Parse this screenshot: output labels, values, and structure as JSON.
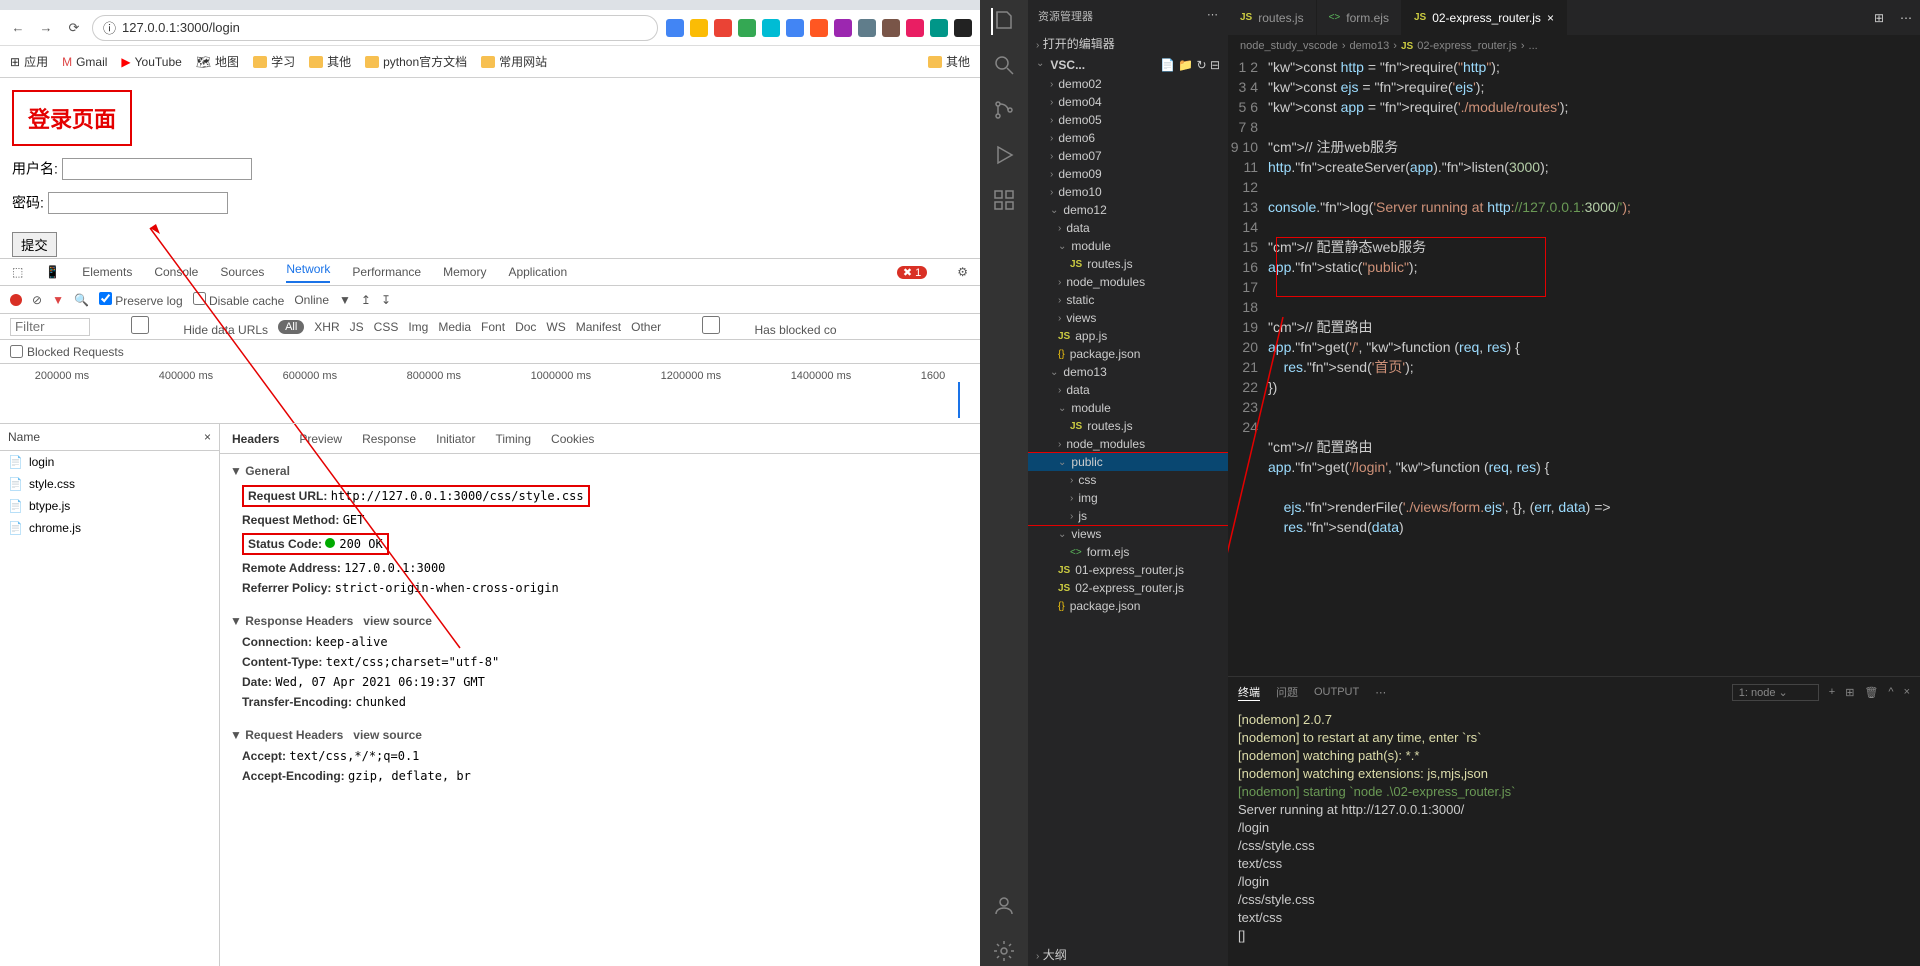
{
  "browser": {
    "url": "127.0.0.1:3000/login",
    "bookmarks": {
      "apps": "应用",
      "gmail": "Gmail",
      "youtube": "YouTube",
      "maps": "地图",
      "study": "学习",
      "other": "其他",
      "python": "python官方文档",
      "sites": "常用网站",
      "other2": "其他"
    }
  },
  "page": {
    "title": "登录页面",
    "user_label": "用户名:",
    "pass_label": "密码:",
    "submit": "提交"
  },
  "devtools": {
    "tabs": {
      "elements": "Elements",
      "console": "Console",
      "sources": "Sources",
      "network": "Network",
      "perf": "Performance",
      "memory": "Memory",
      "app": "Application"
    },
    "errors": "1",
    "preserve": "Preserve log",
    "disable": "Disable cache",
    "online": "Online",
    "filter_ph": "Filter",
    "hide": "Hide data URLs",
    "all": "All",
    "types": [
      "XHR",
      "JS",
      "CSS",
      "Img",
      "Media",
      "Font",
      "Doc",
      "WS",
      "Manifest",
      "Other"
    ],
    "blocked_ck": "Has blocked co",
    "blocked": "Blocked Requests",
    "times": [
      "200000 ms",
      "400000 ms",
      "600000 ms",
      "800000 ms",
      "1000000 ms",
      "1200000 ms",
      "1400000 ms",
      "1600"
    ],
    "name_hdr": "Name",
    "files": [
      "login",
      "style.css",
      "btype.js",
      "chrome.js"
    ],
    "dtabs": {
      "headers": "Headers",
      "preview": "Preview",
      "response": "Response",
      "initiator": "Initiator",
      "timing": "Timing",
      "cookies": "Cookies"
    },
    "general": "General",
    "req_url_l": "Request URL:",
    "req_url": "http://127.0.0.1:3000/css/style.css",
    "req_m_l": "Request Method:",
    "req_m": "GET",
    "stat_l": "Status Code:",
    "stat": "200 OK",
    "remote_l": "Remote Address:",
    "remote": "127.0.0.1:3000",
    "ref_l": "Referrer Policy:",
    "ref": "strict-origin-when-cross-origin",
    "resp_h": "Response Headers",
    "view_src": "view source",
    "conn_l": "Connection:",
    "conn": "keep-alive",
    "ct_l": "Content-Type:",
    "ct": "text/css;charset=\"utf-8\"",
    "date_l": "Date:",
    "date": "Wed, 07 Apr 2021 06:19:37 GMT",
    "te_l": "Transfer-Encoding:",
    "te": "chunked",
    "req_h": "Request Headers",
    "acc_l": "Accept:",
    "acc": "text/css,*/*;q=0.1",
    "ae_l": "Accept-Encoding:",
    "ae": "gzip, deflate, br"
  },
  "vscode": {
    "explorer": "资源管理器",
    "open_editors": "打开的编辑器",
    "ws": "VSC...",
    "tree": [
      "demo02",
      "demo04",
      "demo05",
      "demo6",
      "demo07",
      "demo09",
      "demo10"
    ],
    "demo12": {
      "name": "demo12",
      "data": "data",
      "module": "module",
      "routes": "routes.js",
      "nm": "node_modules",
      "static": "static",
      "views": "views",
      "app": "app.js",
      "pkg": "package.json"
    },
    "demo13": {
      "name": "demo13",
      "data": "data",
      "module": "module",
      "routes": "routes.js",
      "nm": "node_modules",
      "public": "public",
      "css": "css",
      "img": "img",
      "js": "js",
      "views": "views",
      "form": "form.ejs",
      "r1": "01-express_router.js",
      "r2": "02-express_router.js",
      "pkg": "package.json"
    },
    "outline": "大纲",
    "tabs": {
      "t1": "routes.js",
      "t2": "form.ejs",
      "t3": "02-express_router.js"
    },
    "crumb": [
      "node_study_vscode",
      "demo13",
      "02-express_router.js",
      "..."
    ],
    "code_lines": [
      "const http = require(\"http\");",
      "const ejs = require('ejs');",
      "const app = require('./module/routes');",
      "",
      "// 注册web服务",
      "http.createServer(app).listen(3000);",
      "",
      "console.log('Server running at http://127.0.0.1:3000/');",
      "",
      "// 配置静态web服务",
      "app.static(\"public\");",
      "",
      "",
      "// 配置路由",
      "app.get('/', function (req, res) {",
      "    res.send('首页');",
      "})",
      "",
      "",
      "// 配置路由",
      "app.get('/login', function (req, res) {",
      "",
      "    ejs.renderFile('./views/form.ejs', {}, (err, data) =>",
      "    res.send(data)"
    ],
    "term_tabs": {
      "t1": "终端",
      "t2": "问题",
      "t3": "OUTPUT",
      "sel": "1: node"
    },
    "term": [
      "[nodemon] 2.0.7",
      "[nodemon] to restart at any time, enter `rs`",
      "[nodemon] watching path(s): *.*",
      "[nodemon] watching extensions: js,mjs,json",
      "[nodemon] starting `node .\\02-express_router.js`",
      "Server running at http://127.0.0.1:3000/",
      "/login",
      "/css/style.css",
      "text/css",
      "/login",
      "/css/style.css",
      "text/css",
      "[]"
    ]
  }
}
